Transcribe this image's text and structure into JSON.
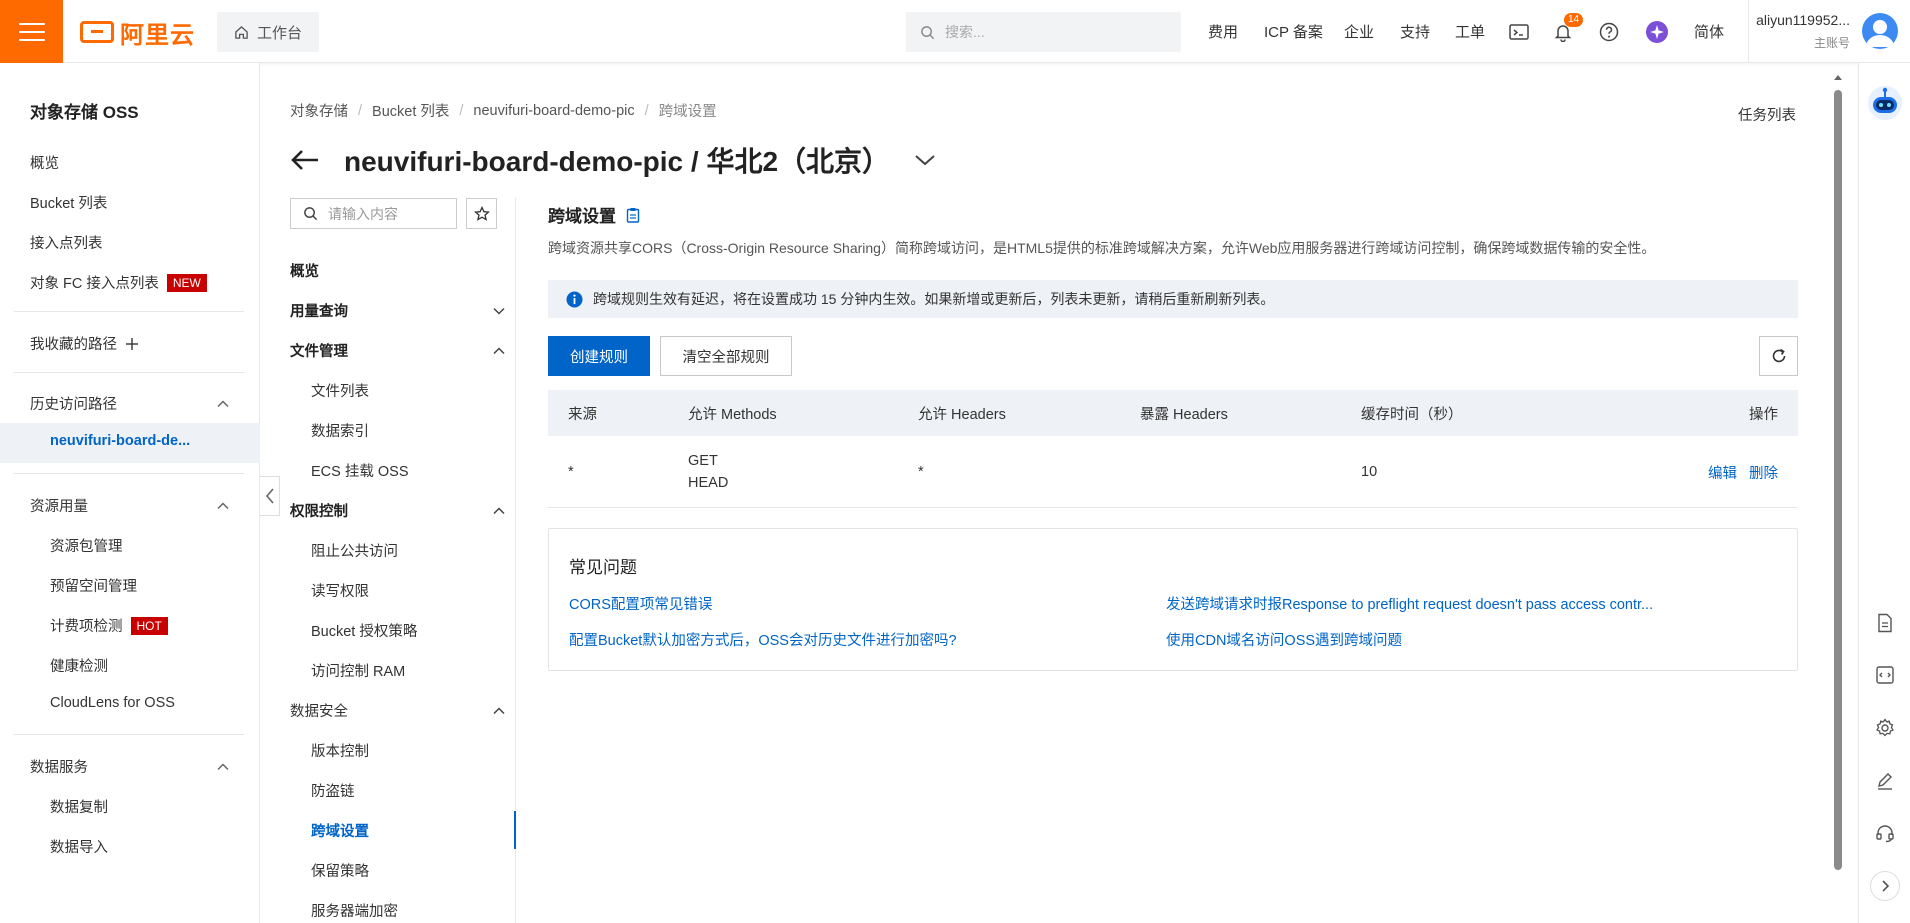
{
  "topbar": {
    "logo_text": "阿里云",
    "workbench_label": "工作台",
    "search_placeholder": "搜索...",
    "nav": [
      "费用",
      "ICP 备案",
      "企业",
      "支持",
      "工单"
    ],
    "notification_count": "14",
    "language": "简体",
    "account_name": "aliyun119952...",
    "account_type": "主账号"
  },
  "sidebar": {
    "title": "对象存储 OSS",
    "items": [
      "概览",
      "Bucket 列表",
      "接入点列表",
      "对象 FC 接入点列表"
    ],
    "new_badge": "NEW",
    "favorites_label": "我收藏的路径",
    "history_section": "历史访问路径",
    "history_item": "neuvifuri-board-de...",
    "resource_section": "资源用量",
    "resource_items": [
      "资源包管理",
      "预留空间管理",
      "计费项检测",
      "健康检测",
      "CloudLens for OSS"
    ],
    "hot_badge": "HOT",
    "data_section": "数据服务",
    "data_items": [
      "数据复制",
      "数据导入"
    ]
  },
  "breadcrumb": [
    "对象存储",
    "Bucket 列表",
    "neuvifuri-board-demo-pic",
    "跨域设置"
  ],
  "tasks_label": "任务列表",
  "page_title": "neuvifuri-board-demo-pic / 华北2（北京）",
  "subnav": {
    "search_placeholder": "请输入内容",
    "overview": "概览",
    "usage": "用量查询",
    "file_mgmt": "文件管理",
    "file_items": [
      "文件列表",
      "数据索引",
      "ECS 挂载 OSS"
    ],
    "access_ctrl": "权限控制",
    "access_items": [
      "阻止公共访问",
      "读写权限",
      "Bucket 授权策略",
      "访问控制 RAM"
    ],
    "data_security": "数据安全",
    "security_items": [
      "版本控制",
      "防盗链",
      "跨域设置",
      "保留策略",
      "服务器端加密"
    ]
  },
  "content": {
    "title": "跨域设置",
    "description": "跨域资源共享CORS（Cross-Origin Resource Sharing）简称跨域访问，是HTML5提供的标准跨域解决方案，允许Web应用服务器进行跨域访问控制，确保跨域数据传输的安全性。",
    "notice": "跨域规则生效有延迟，将在设置成功 15 分钟内生效。如果新增或更新后，列表未更新，请稍后重新刷新列表。",
    "create_btn": "创建规则",
    "clear_btn": "清空全部规则",
    "table": {
      "headers": [
        "来源",
        "允许 Methods",
        "允许 Headers",
        "暴露 Headers",
        "缓存时间（秒）",
        "操作"
      ],
      "rows": [
        {
          "origin": "*",
          "method1": "GET",
          "method2": "HEAD",
          "allow_headers": "*",
          "expose_headers": "",
          "cache": "10",
          "edit": "编辑",
          "delete": "删除"
        }
      ]
    },
    "faq": {
      "title": "常见问题",
      "links": [
        "CORS配置项常见错误",
        "发送跨域请求时报Response to preflight request doesn't pass access contr...",
        "配置Bucket默认加密方式后，OSS会对历史文件进行加密吗?",
        "使用CDN域名访问OSS遇到跨域问题"
      ]
    }
  },
  "colors": {
    "brand": "#ff6a00",
    "primary": "#0064c8",
    "badge": "#c80000"
  }
}
